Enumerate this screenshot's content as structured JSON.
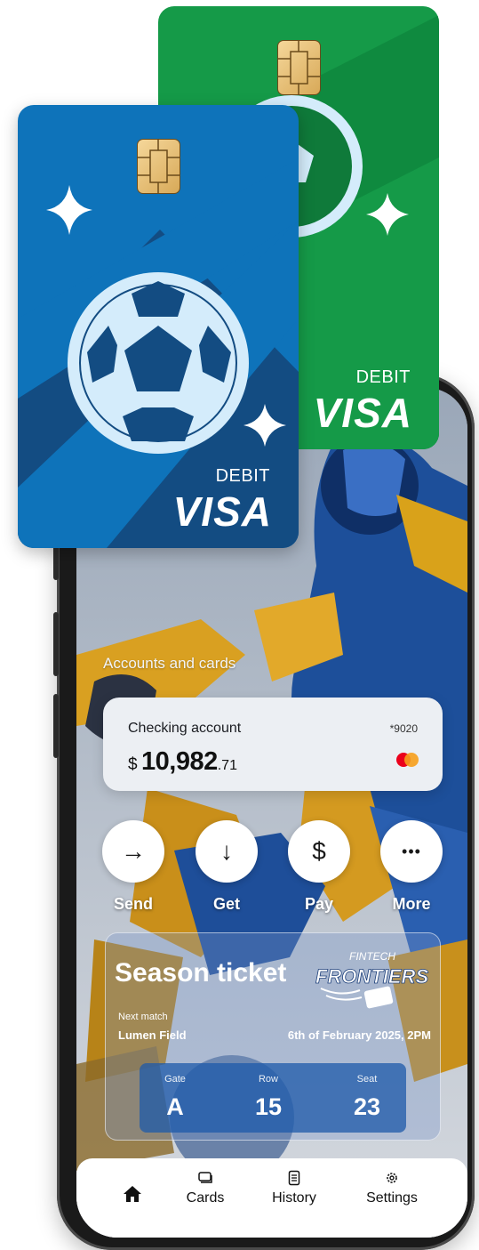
{
  "cards": [
    {
      "id": "green",
      "type_label": "DEBIT",
      "brand": "VISA",
      "color": "#159a48"
    },
    {
      "id": "blue",
      "type_label": "DEBIT",
      "brand": "VISA",
      "color": "#0e73ba"
    }
  ],
  "accounts": {
    "section_title": "Accounts and cards",
    "checking": {
      "name": "Checking account",
      "number": "*9020",
      "currency": "$",
      "amount_main": "10,982",
      "amount_cents": ".71"
    }
  },
  "actions": [
    {
      "label": "Send",
      "icon": "arrow-right-icon",
      "glyph": "→"
    },
    {
      "label": "Get",
      "icon": "arrow-down-icon",
      "glyph": "↓"
    },
    {
      "label": "Pay",
      "icon": "dollar-icon",
      "glyph": "$"
    },
    {
      "label": "More",
      "icon": "more-icon",
      "glyph": "•••"
    }
  ],
  "ticket": {
    "title": "Season ticket",
    "logo_top": "FINTECH",
    "logo_main": "FRONTIERS",
    "next_match_label": "Next match",
    "venue": "Lumen Field",
    "date": "6th of February 2025, 2PM",
    "gate_label": "Gate",
    "gate": "A",
    "row_label": "Row",
    "row": "15",
    "seat_label": "Seat",
    "seat": "23"
  },
  "nav": [
    {
      "label": "",
      "icon": "home-icon"
    },
    {
      "label": "Cards",
      "icon": "cards-icon"
    },
    {
      "label": "History",
      "icon": "history-icon"
    },
    {
      "label": "Settings",
      "icon": "settings-icon"
    }
  ]
}
